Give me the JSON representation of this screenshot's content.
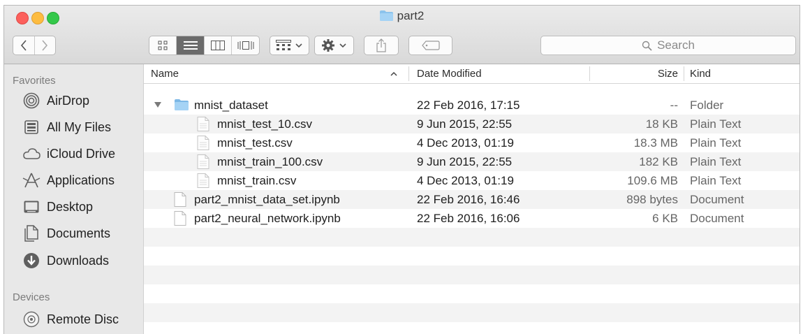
{
  "window": {
    "title": "part2"
  },
  "toolbar": {
    "search_placeholder": "Search",
    "view_modes": [
      "icon-view",
      "list-view",
      "column-view",
      "cover-flow-view"
    ]
  },
  "sidebar": {
    "favorites_heading": "Favorites",
    "favorites": [
      {
        "label": "AirDrop",
        "icon": "airdrop-icon"
      },
      {
        "label": "All My Files",
        "icon": "all-my-files-icon"
      },
      {
        "label": "iCloud Drive",
        "icon": "cloud-icon"
      },
      {
        "label": "Applications",
        "icon": "applications-icon"
      },
      {
        "label": "Desktop",
        "icon": "desktop-icon"
      },
      {
        "label": "Documents",
        "icon": "documents-icon"
      },
      {
        "label": "Downloads",
        "icon": "downloads-icon"
      }
    ],
    "devices_heading": "Devices",
    "devices": [
      {
        "label": "Remote Disc",
        "icon": "disc-icon"
      }
    ]
  },
  "columns": {
    "name": "Name",
    "date": "Date Modified",
    "size": "Size",
    "kind": "Kind"
  },
  "files": [
    {
      "name": "mnist_dataset",
      "date": "22 Feb 2016, 17:15",
      "size": "--",
      "kind": "Folder"
    },
    {
      "name": "mnist_test_10.csv",
      "date": "9 Jun 2015, 22:55",
      "size": "18 KB",
      "kind": "Plain Text"
    },
    {
      "name": "mnist_test.csv",
      "date": "4 Dec 2013, 01:19",
      "size": "18.3 MB",
      "kind": "Plain Text"
    },
    {
      "name": "mnist_train_100.csv",
      "date": "9 Jun 2015, 22:55",
      "size": "182 KB",
      "kind": "Plain Text"
    },
    {
      "name": "mnist_train.csv",
      "date": "4 Dec 2013, 01:19",
      "size": "109.6 MB",
      "kind": "Plain Text"
    },
    {
      "name": "part2_mnist_data_set.ipynb",
      "date": "22 Feb 2016, 16:46",
      "size": "898 bytes",
      "kind": "Document"
    },
    {
      "name": "part2_neural_network.ipynb",
      "date": "22 Feb 2016, 16:06",
      "size": "6 KB",
      "kind": "Document"
    }
  ],
  "colors": {
    "folder_blue": "#8cc3ec",
    "selected_segment": "#6b6b6b",
    "sidebar_bg": "#e8e8e8"
  }
}
